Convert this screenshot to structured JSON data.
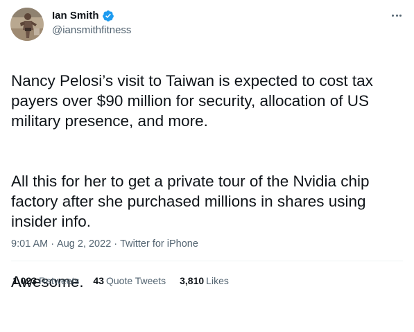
{
  "author": {
    "display_name": "Ian Smith",
    "handle": "@iansmithfitness",
    "verified": true
  },
  "icons": {
    "verified": "verified-badge-icon",
    "more": "more-options-icon",
    "avatar": "profile-photo"
  },
  "tweet": {
    "paragraphs": [
      "Nancy Pelosi’s visit to Taiwan is expected to cost tax payers over $90 million for security, allocation of US military presence, and more.",
      "All this for her to get a private tour of the Nvidia chip factory after she purchased millions in shares using insider info.",
      "Awesome."
    ],
    "time": "9:01 AM",
    "date": "Aug 2, 2022",
    "source": "Twitter for iPhone",
    "separator": "·"
  },
  "stats": {
    "retweets_count": "1,023",
    "retweets_label": "Retweets",
    "quotes_count": "43",
    "quotes_label": "Quote Tweets",
    "likes_count": "3,810",
    "likes_label": "Likes"
  },
  "colors": {
    "text": "#0f1419",
    "secondary": "#536471",
    "verified": "#1d9bf0",
    "divider": "#eff3f4"
  }
}
